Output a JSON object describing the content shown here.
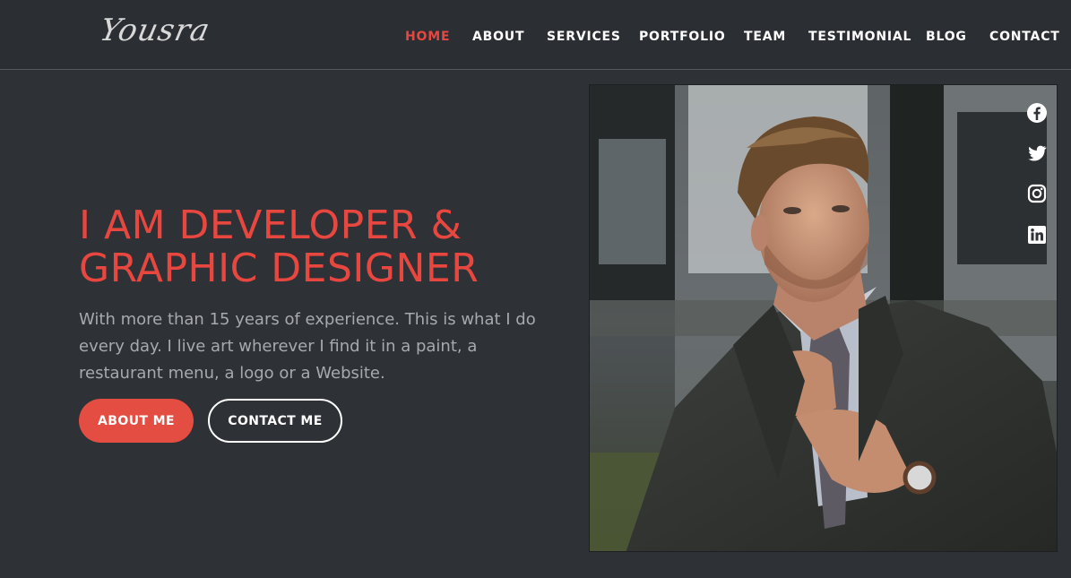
{
  "brand": {
    "logo_text": "Yousra"
  },
  "nav": {
    "items": [
      {
        "label": "HOME",
        "active": true
      },
      {
        "label": "ABOUT"
      },
      {
        "label": "SERVICES"
      },
      {
        "label": "PORTFOLIO"
      },
      {
        "label": "TEAM"
      },
      {
        "label": "TESTIMONIAL"
      },
      {
        "label": "BLOG"
      },
      {
        "label": "CONTACT"
      }
    ]
  },
  "hero": {
    "title_line1": "I AM DEVELOPER &",
    "title_line2": "GRAPHIC DESIGNER",
    "description": "With more than 15 years of experience. This is what I do every day. I live art wherever I find it in a paint, a restaurant menu, a logo or a Website.",
    "about_button": "ABOUT ME",
    "contact_button": "CONTACT ME"
  },
  "social": {
    "icons": [
      "facebook-icon",
      "twitter-icon",
      "instagram-icon",
      "linkedin-icon"
    ]
  },
  "colors": {
    "accent": "#e8473f",
    "background": "#2e3135",
    "header_bg": "#2b2e32",
    "body_text": "#a7a9ad"
  }
}
